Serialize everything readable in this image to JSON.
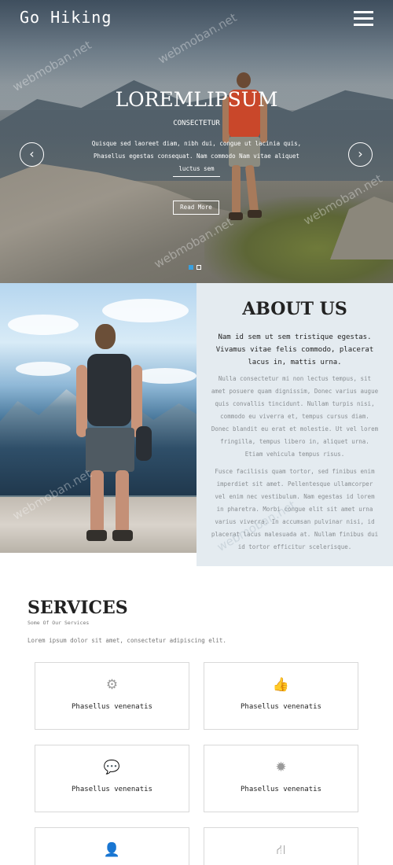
{
  "header": {
    "brand": "Go Hiking",
    "menu_icon": "hamburger-menu-icon"
  },
  "hero": {
    "title": "LOREMLIPSUM",
    "subtitle": "CONSECTETUR",
    "text": "Quisque sed laoreet diam, nibh dui, congue ut lacinia quis, Phasellus egestas consequat. Nam commodo Nam vitae aliquet luctus sem",
    "read_more": "Read More",
    "prev_icon": "chevron-left-icon",
    "next_icon": "chevron-right-icon",
    "prev_glyph": "‹",
    "next_glyph": "›",
    "slides_active": 1,
    "slides_total": 2
  },
  "about": {
    "title": "ABOUT US",
    "lead": "Nam id sem ut sem tristique egestas. Vivamus vitae felis commodo, placerat lacus in, mattis urna.",
    "paragraph1": "Nulla consectetur mi non lectus tempus, sit amet posuere quam dignissim, Donec varius augue quis convallis tincidunt. Nullam turpis nisi, commodo eu viverra et, tempus cursus diam. Donec blandit eu erat et molestie. Ut vel lorem fringilla, tempus libero in, aliquet urna. Etiam vehicula tempus risus.",
    "paragraph2": "Fusce facilisis quam tortor, sed finibus enim imperdiet sit amet. Pellentesque ullamcorper vel enim nec vestibulum. Nam egestas id lorem in pharetra. Morbi congue elit sit amet urna varius viverra. In accumsan pulvinar nisi, id placerat lacus malesuada at. Nullam finibus dui id tortor efficitur scelerisque."
  },
  "services": {
    "title": "SERVICES",
    "subtitle": "Some Of Our Services",
    "text": "Lorem ipsum dolor sit amet, consectetur adipiscing elit.",
    "items": [
      {
        "label": "Phasellus venenatis",
        "icon": "gears-icon",
        "glyph": "⚙"
      },
      {
        "label": "Phasellus venenatis",
        "icon": "thumbs-up-icon",
        "glyph": "👍"
      },
      {
        "label": "Phasellus venenatis",
        "icon": "comments-icon",
        "glyph": "💬"
      },
      {
        "label": "Phasellus venenatis",
        "icon": "certificate-icon",
        "glyph": "✹"
      },
      {
        "label": "",
        "icon": "user-icon",
        "glyph": "👤"
      },
      {
        "label": "",
        "icon": "road-icon",
        "glyph": "⛙"
      }
    ]
  },
  "watermark": "webmoban.net",
  "colors": {
    "accent": "#3aa0de",
    "about_bg": "#e4ebf0",
    "text_dark": "#222222",
    "text_muted": "#8a8f93"
  }
}
